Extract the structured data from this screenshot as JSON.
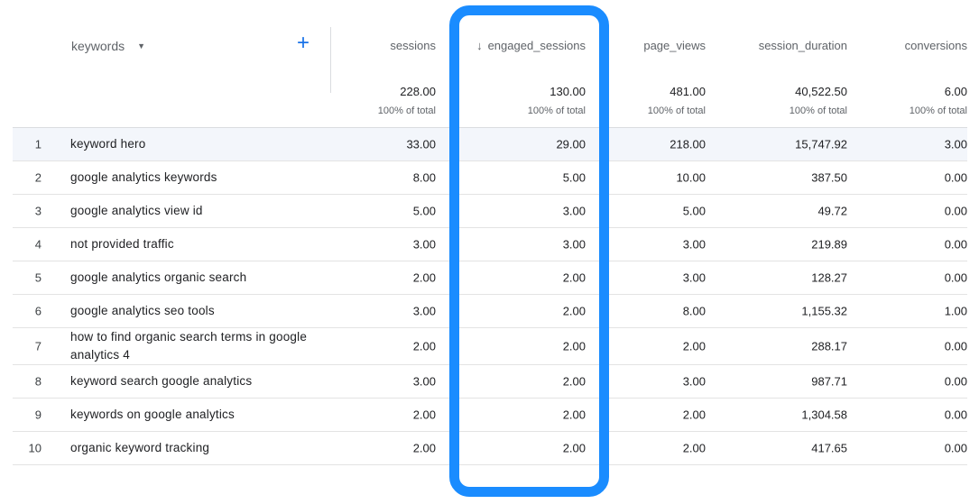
{
  "header": {
    "dimension_label": "keywords",
    "columns": [
      {
        "label": "sessions",
        "total": "228.00",
        "pct": "100% of total"
      },
      {
        "label": "engaged_sessions",
        "total": "130.00",
        "pct": "100% of total",
        "sorted": true
      },
      {
        "label": "page_views",
        "total": "481.00",
        "pct": "100% of total"
      },
      {
        "label": "session_duration",
        "total": "40,522.50",
        "pct": "100% of total"
      },
      {
        "label": "conversions",
        "total": "6.00",
        "pct": "100% of total"
      }
    ]
  },
  "rows": [
    {
      "n": "1",
      "kw": "keyword hero",
      "v": [
        "33.00",
        "29.00",
        "218.00",
        "15,747.92",
        "3.00"
      ]
    },
    {
      "n": "2",
      "kw": "google analytics keywords",
      "v": [
        "8.00",
        "5.00",
        "10.00",
        "387.50",
        "0.00"
      ]
    },
    {
      "n": "3",
      "kw": "google analytics view id",
      "v": [
        "5.00",
        "3.00",
        "5.00",
        "49.72",
        "0.00"
      ]
    },
    {
      "n": "4",
      "kw": "not provided traffic",
      "v": [
        "3.00",
        "3.00",
        "3.00",
        "219.89",
        "0.00"
      ]
    },
    {
      "n": "5",
      "kw": "google analytics organic search",
      "v": [
        "2.00",
        "2.00",
        "3.00",
        "128.27",
        "0.00"
      ]
    },
    {
      "n": "6",
      "kw": "google analytics seo tools",
      "v": [
        "3.00",
        "2.00",
        "8.00",
        "1,155.32",
        "1.00"
      ]
    },
    {
      "n": "7",
      "kw": "how to find organic search terms in google analytics 4",
      "v": [
        "2.00",
        "2.00",
        "2.00",
        "288.17",
        "0.00"
      ]
    },
    {
      "n": "8",
      "kw": "keyword search google analytics",
      "v": [
        "3.00",
        "2.00",
        "3.00",
        "987.71",
        "0.00"
      ]
    },
    {
      "n": "9",
      "kw": "keywords on google analytics",
      "v": [
        "2.00",
        "2.00",
        "2.00",
        "1,304.58",
        "0.00"
      ]
    },
    {
      "n": "10",
      "kw": "organic keyword tracking",
      "v": [
        "2.00",
        "2.00",
        "2.00",
        "417.65",
        "0.00"
      ]
    }
  ],
  "colors": {
    "accent": "#1a73e8",
    "highlight": "#1a8cff"
  },
  "icons": {
    "sort": "arrow-down-icon",
    "dropdown": "caret-down-icon",
    "add": "plus-icon"
  }
}
